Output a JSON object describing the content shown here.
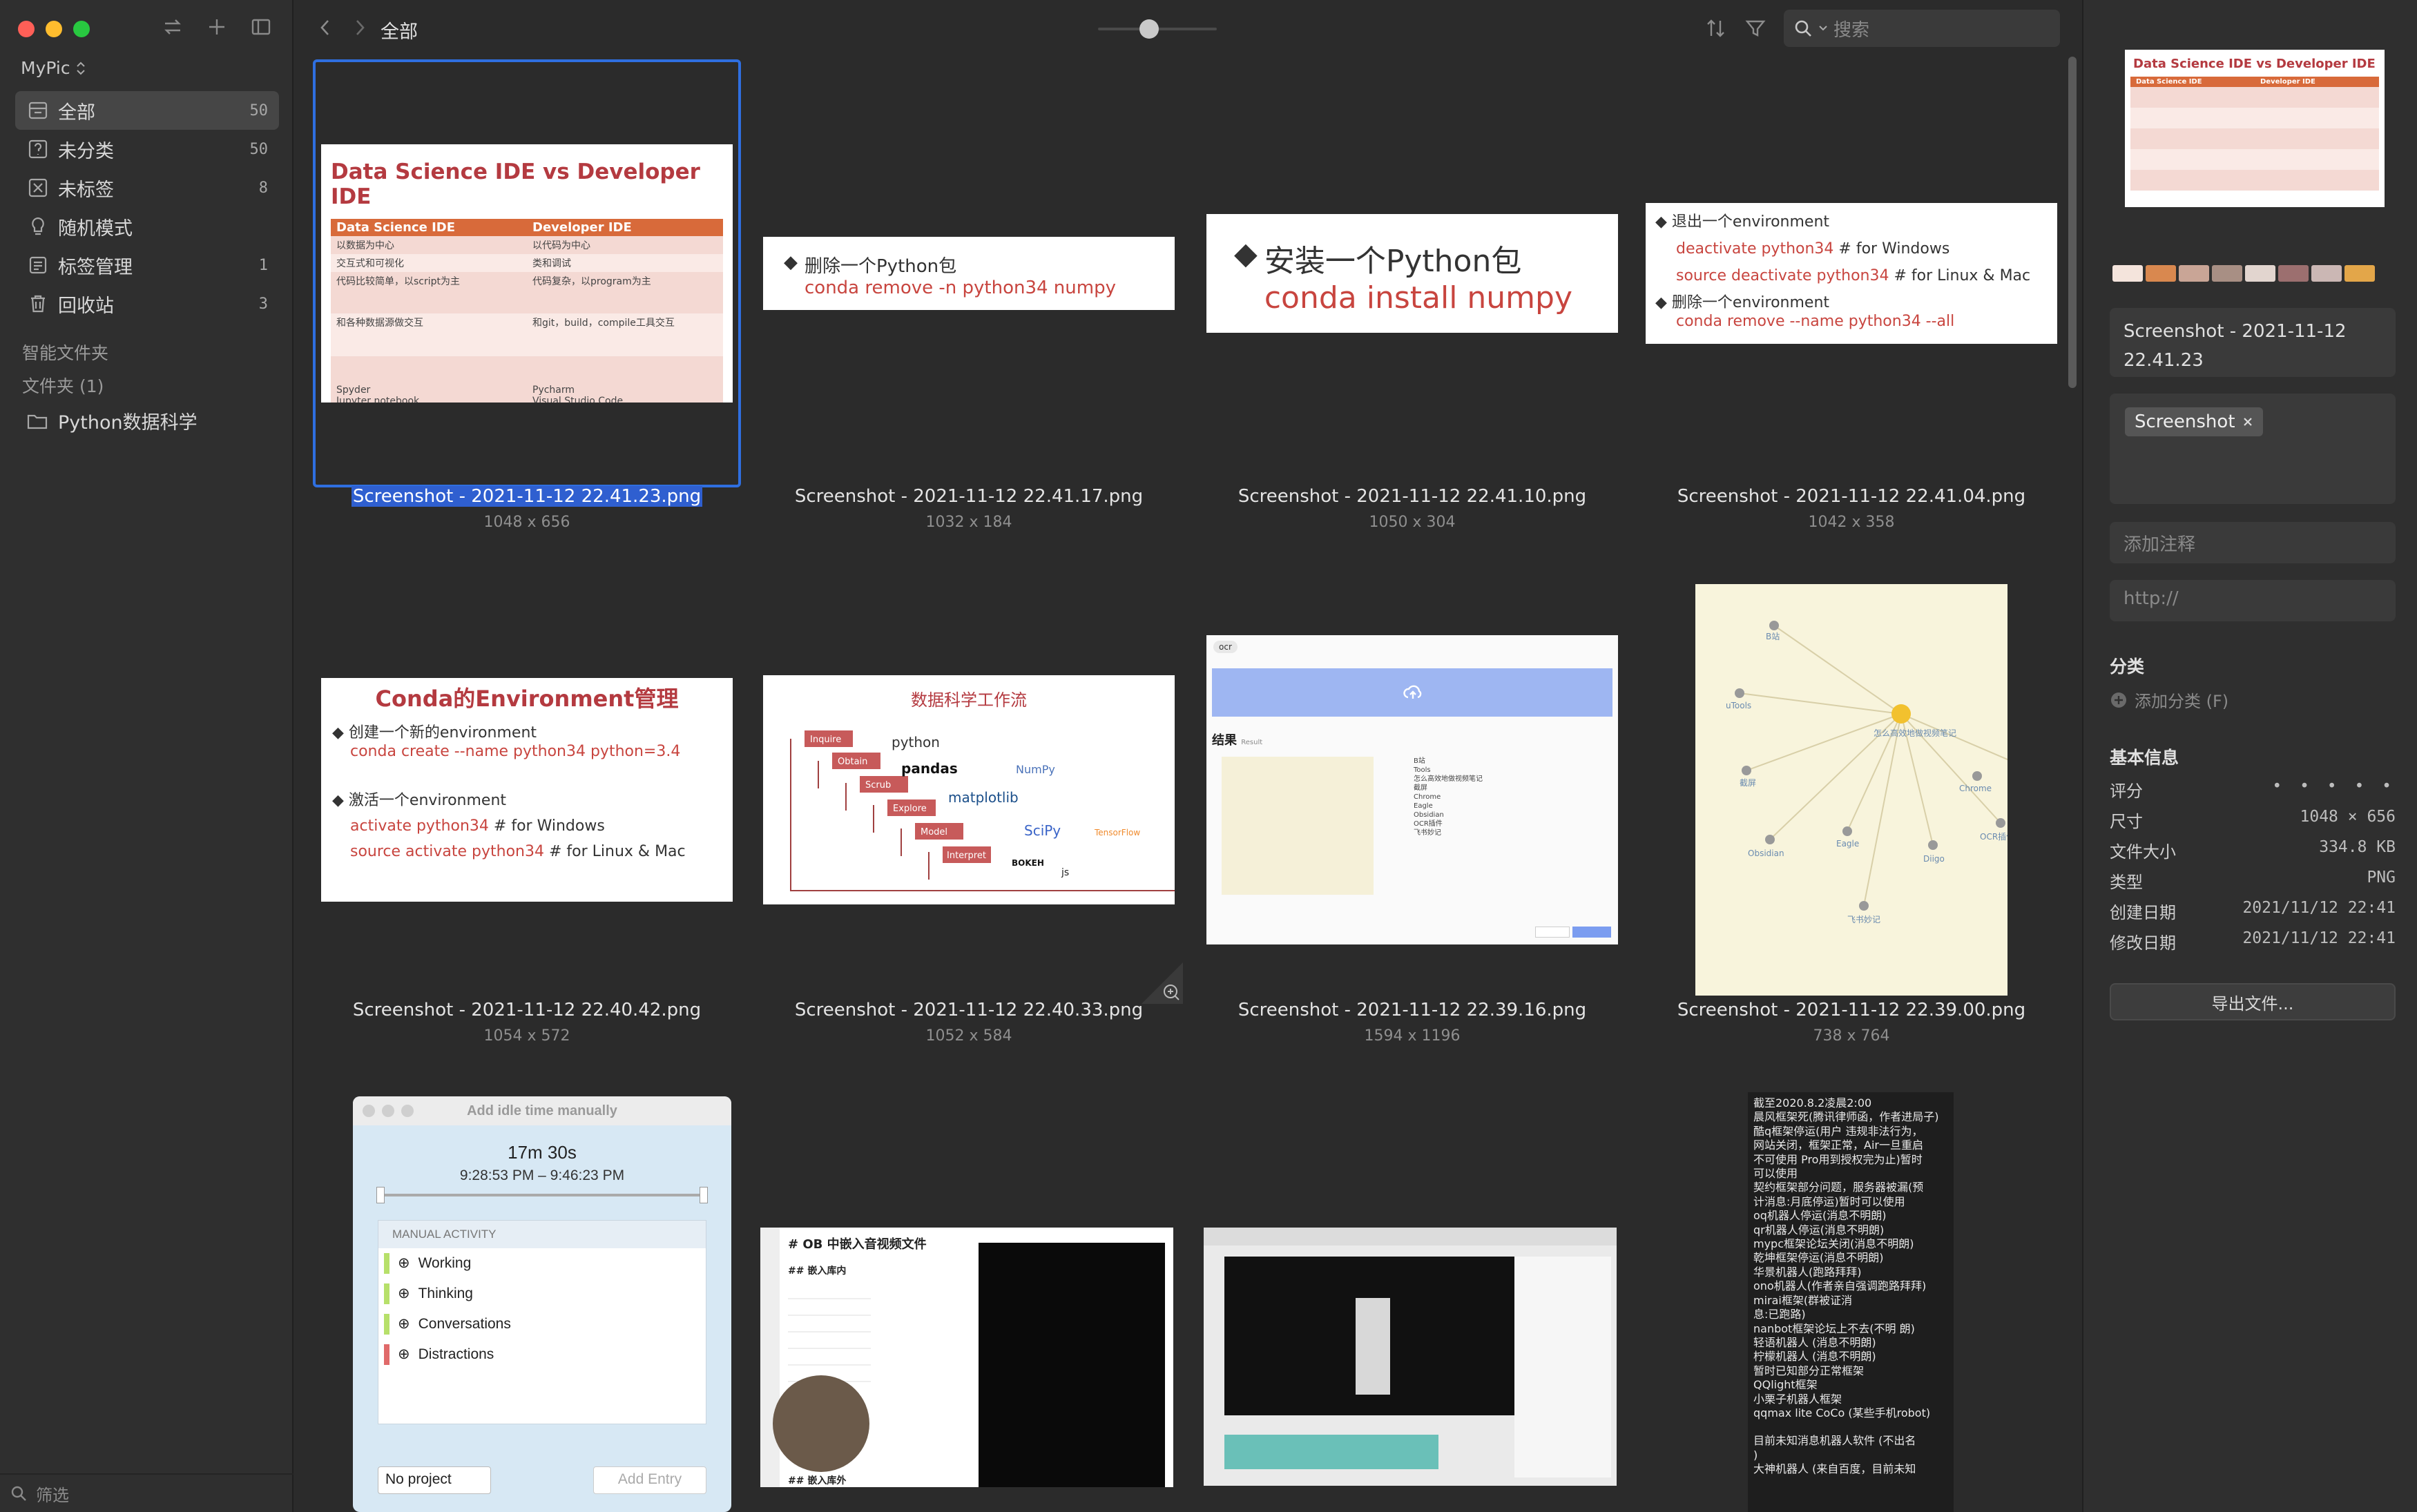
{
  "sidebar": {
    "library": "MyPic",
    "items": [
      {
        "label": "全部",
        "count": "50"
      },
      {
        "label": "未分类",
        "count": "50"
      },
      {
        "label": "未标签",
        "count": "8"
      },
      {
        "label": "随机模式",
        "count": ""
      },
      {
        "label": "标签管理",
        "count": "1"
      },
      {
        "label": "回收站",
        "count": "3"
      }
    ],
    "smart_folders": "智能文件夹",
    "folders_heading": "文件夹 (1)",
    "folder": "Python数据科学",
    "filter_placeholder": "筛选"
  },
  "toolbar": {
    "title": "全部",
    "search_placeholder": "搜索"
  },
  "grid": [
    {
      "name": "Screenshot - 2021-11-12 22.41.23.png",
      "dims": "1048 x 656",
      "selected": true
    },
    {
      "name": "Screenshot - 2021-11-12 22.41.17.png",
      "dims": "1032 x 184"
    },
    {
      "name": "Screenshot - 2021-11-12 22.41.10.png",
      "dims": "1050 x 304"
    },
    {
      "name": "Screenshot - 2021-11-12 22.41.04.png",
      "dims": "1042 x 358"
    },
    {
      "name": "Screenshot - 2021-11-12 22.40.42.png",
      "dims": "1054 x 572"
    },
    {
      "name": "Screenshot - 2021-11-12 22.40.33.png",
      "dims": "1052 x 584"
    },
    {
      "name": "Screenshot - 2021-11-12 22.39.16.png",
      "dims": "1594 x 1196"
    },
    {
      "name": "Screenshot - 2021-11-12 22.39.00.png",
      "dims": "738 x 764"
    }
  ],
  "thumbs": {
    "t1": {
      "title": "Data Science IDE vs Developer IDE",
      "col1": "Data Science IDE",
      "col2": "Developer IDE",
      "rows": [
        [
          "以数据为中心",
          "以代码为中心"
        ],
        [
          "交互式和可视化",
          "类和调试"
        ],
        [
          "代码比较简单，以script为主",
          "代码复杂，以program为主"
        ],
        [
          "和各种数据源做交互",
          "和git，build，compile工具交互"
        ],
        [
          "Spyder\nJupyter notebook\nJupyterLab",
          "Pycharm\nVisual Studio Code\nSublime Text"
        ]
      ]
    },
    "t2": {
      "line1": "删除一个Python包",
      "line2": "conda remove -n python34 numpy"
    },
    "t3": {
      "line1": "安装一个Python包",
      "line2": "conda install numpy"
    },
    "t4": {
      "a": "退出一个environment",
      "b": "deactivate python34",
      "b_c": "# for Windows",
      "c": "source deactivate python34",
      "c_c": "# for Linux & Mac",
      "d": "删除一个environment",
      "e": "conda remove --name python34 --all"
    },
    "t5": {
      "title": "Conda的Environment管理",
      "a": "创建一个新的environment",
      "b": "conda create --name python34 python=3.4",
      "c": "激活一个environment",
      "d": "activate python34",
      "d_c": "# for Windows",
      "e": "source activate python34",
      "e_c": "# for Linux & Mac"
    },
    "t6": {
      "title": "数据科学工作流",
      "steps": [
        "Inquire",
        "Obtain",
        "Scrub",
        "Explore",
        "Model",
        "Interpret"
      ],
      "libs": [
        "python",
        "pandas",
        "NumPy",
        "matplotlib",
        "SciPy",
        "TensorFlow",
        "BOKEH",
        "js"
      ]
    },
    "t7": {
      "tag": "ocr",
      "result": "结果",
      "result_sub": "Result",
      "list": [
        "B站",
        "Tools",
        "怎么高效地做视频笔记",
        "截屏",
        "Chrome",
        "Eagle",
        "Obsidian",
        "OCR插件",
        "飞书妙记"
      ]
    },
    "t8": {
      "center": "怎么高效地做视频笔记",
      "nodes": [
        "B站",
        "uTools",
        "截屏",
        "Obsidian",
        "Eagle",
        "飞书妙记",
        "Diigo",
        "OCR插件",
        "Chrome"
      ]
    },
    "t9": {
      "title": "Add idle time manually",
      "duration": "17m 30s",
      "range": "9:28:53 PM – 9:46:23 PM",
      "section": "MANUAL ACTIVITY",
      "items": [
        "Working",
        "Thinking",
        "Conversations",
        "Distractions"
      ],
      "project": "No project",
      "add": "Add Entry"
    },
    "t10": {
      "heading": "# OB 中嵌入音视频文件",
      "sub": "## 嵌入库内",
      "bottom": "## 嵌入库外"
    },
    "t12": {
      "lines": [
        "截至2020.8.2凌晨2:00",
        "晨风框架死(腾讯律师函，作者进局子)",
        "酷q框架停运(用户 违规非法行为，",
        "网站关闭，框架正常，Air一旦重启",
        "不可使用 Pro用到授权完为止)暂时",
        "可以使用",
        "契约框架部分问题，服务器被漏(预",
        "计消息:月底停运)暂时可以使用",
        "oq机器人停运(消息不明朗)",
        "qr机器人停运(消息不明朗)",
        "mypc框架论坛关闭(消息不明朗)",
        "乾坤框架停运(消息不明朗)",
        "华景机器人(跑路拜拜)",
        "ono机器人(作者亲自强调跑路拜拜)",
        "mirai框架(群被证消",
        "息:已跑路)",
        "nanbot框架论坛上不去(不明 朗)",
        "轻语机器人 (消息不明朗)",
        "柠檬机器人 (消息不明朗)",
        "暂时已知部分正常框架",
        "QQlight框架",
        "小栗子机器人框架",
        "qqmax lite CoCo (某些手机robot)",
        "",
        "目前未知消息机器人软件 (不出名",
        ")",
        "大神机器人 (来自百度，目前未知"
      ]
    }
  },
  "inspector": {
    "title_line1": "Screenshot - 2021-11-12",
    "title_line2": "22.41.23",
    "tag": "Screenshot",
    "note_placeholder": "添加注释",
    "url_placeholder": "http://",
    "category_heading": "分类",
    "add_category": "添加分类 (F)",
    "info_heading": "基本信息",
    "rows": [
      {
        "k": "评分",
        "v": "• • • • •"
      },
      {
        "k": "尺寸",
        "v": "1048 × 656"
      },
      {
        "k": "文件大小",
        "v": "334.8 KB"
      },
      {
        "k": "类型",
        "v": "PNG"
      },
      {
        "k": "创建日期",
        "v": "2021/11/12 22:41"
      },
      {
        "k": "修改日期",
        "v": "2021/11/12 22:41"
      }
    ],
    "export": "导出文件...",
    "palette": [
      "#f4e4dc",
      "#d9884f",
      "#c9a596",
      "#a88f84",
      "#e2d5cf",
      "#9c6f6f",
      "#cbb7b4",
      "#e3a649"
    ]
  }
}
